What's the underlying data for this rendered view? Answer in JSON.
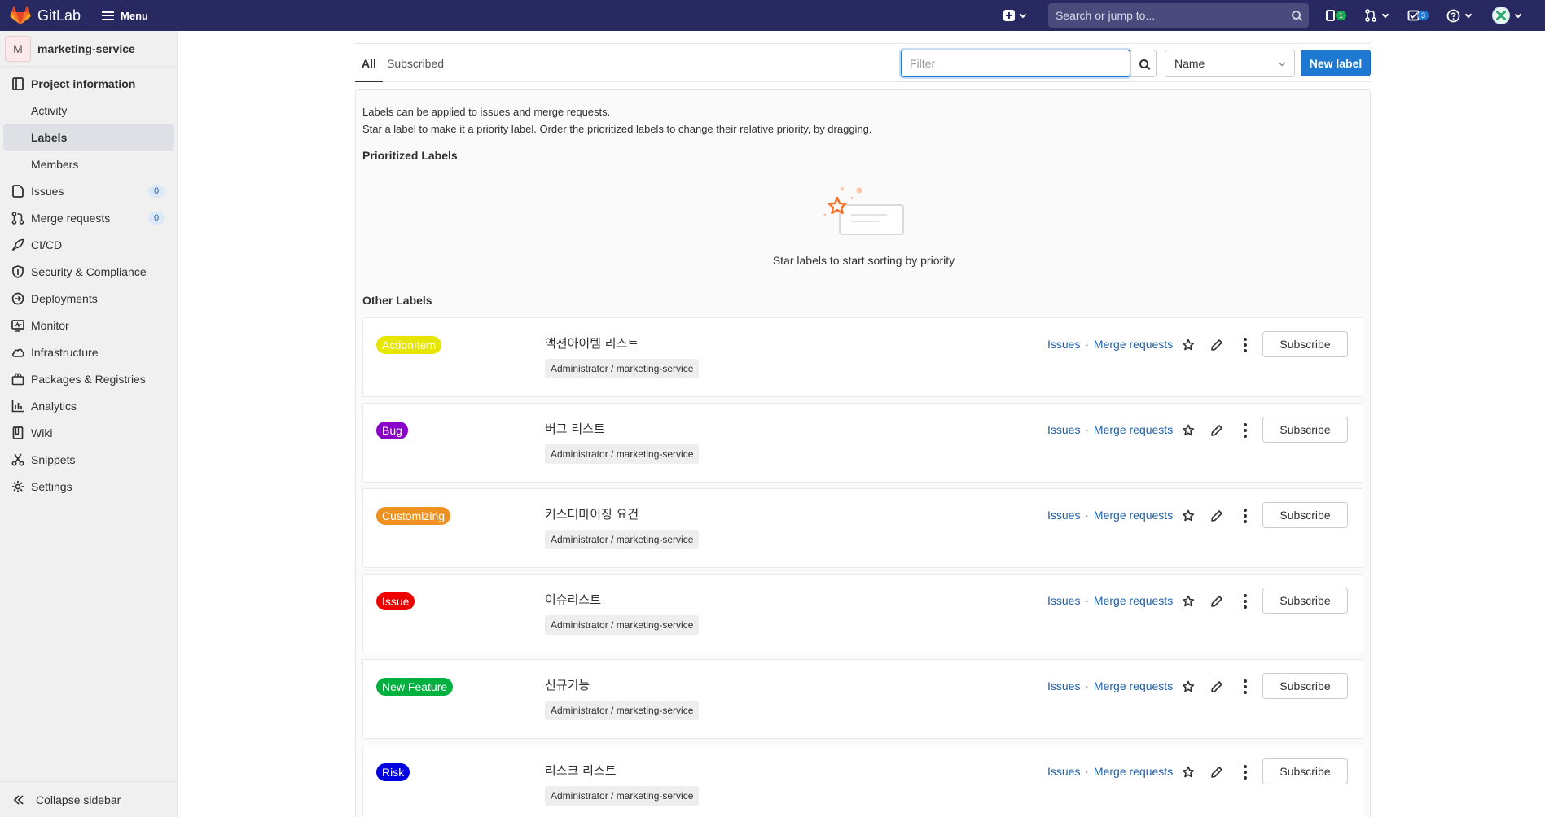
{
  "topbar": {
    "app_name": "GitLab",
    "menu_label": "Menu",
    "search_placeholder": "Search or jump to...",
    "issues_count": "1",
    "todos_count": "3",
    "brand_color": "#292961"
  },
  "sidebar": {
    "project_initial": "M",
    "project_name": "marketing-service",
    "items": [
      {
        "label": "Project information",
        "icon": "project-info-icon"
      },
      {
        "label": "Activity"
      },
      {
        "label": "Labels"
      },
      {
        "label": "Members"
      },
      {
        "label": "Issues",
        "icon": "issues-icon",
        "count": "0"
      },
      {
        "label": "Merge requests",
        "icon": "merge-request-icon",
        "count": "0"
      },
      {
        "label": "CI/CD",
        "icon": "rocket-icon"
      },
      {
        "label": "Security & Compliance",
        "icon": "shield-icon"
      },
      {
        "label": "Deployments",
        "icon": "deployments-icon"
      },
      {
        "label": "Monitor",
        "icon": "monitor-icon"
      },
      {
        "label": "Infrastructure",
        "icon": "cloud-icon"
      },
      {
        "label": "Packages & Registries",
        "icon": "package-icon"
      },
      {
        "label": "Analytics",
        "icon": "chart-icon"
      },
      {
        "label": "Wiki",
        "icon": "book-icon"
      },
      {
        "label": "Snippets",
        "icon": "scissors-icon"
      },
      {
        "label": "Settings",
        "icon": "gear-icon"
      }
    ],
    "collapse_label": "Collapse sidebar"
  },
  "tabs": {
    "all": "All",
    "subscribed": "Subscribed"
  },
  "toolbar": {
    "filter_placeholder": "Filter",
    "sort_value": "Name",
    "new_label": "New label"
  },
  "content": {
    "desc_line1": "Labels can be applied to issues and merge requests.",
    "desc_line2": "Star a label to make it a priority label. Order the prioritized labels to change their relative priority, by dragging.",
    "prioritized_heading": "Prioritized Labels",
    "empty_text": "Star labels to start sorting by priority",
    "other_heading": "Other Labels"
  },
  "labels": [
    {
      "name": "ActionItem",
      "color": "#e6e600",
      "description": "액션아이템 리스트",
      "path": "Administrator / marketing-service"
    },
    {
      "name": "Bug",
      "color": "#8b00c7",
      "description": "버그 리스트",
      "path": "Administrator / marketing-service"
    },
    {
      "name": "Customizing",
      "color": "#ed9121",
      "description": "커스터마이징 요건",
      "path": "Administrator / marketing-service"
    },
    {
      "name": "Issue",
      "color": "#ee0000",
      "description": "이슈리스트",
      "path": "Administrator / marketing-service"
    },
    {
      "name": "New Feature",
      "color": "#00b140",
      "description": "신규기능",
      "path": "Administrator / marketing-service"
    },
    {
      "name": "Risk",
      "color": "#0000e0",
      "description": "리스크 리스트",
      "path": "Administrator / marketing-service"
    }
  ],
  "row_links": {
    "issues": "Issues",
    "separator": "·",
    "merge_requests": "Merge requests",
    "subscribe": "Subscribe"
  }
}
